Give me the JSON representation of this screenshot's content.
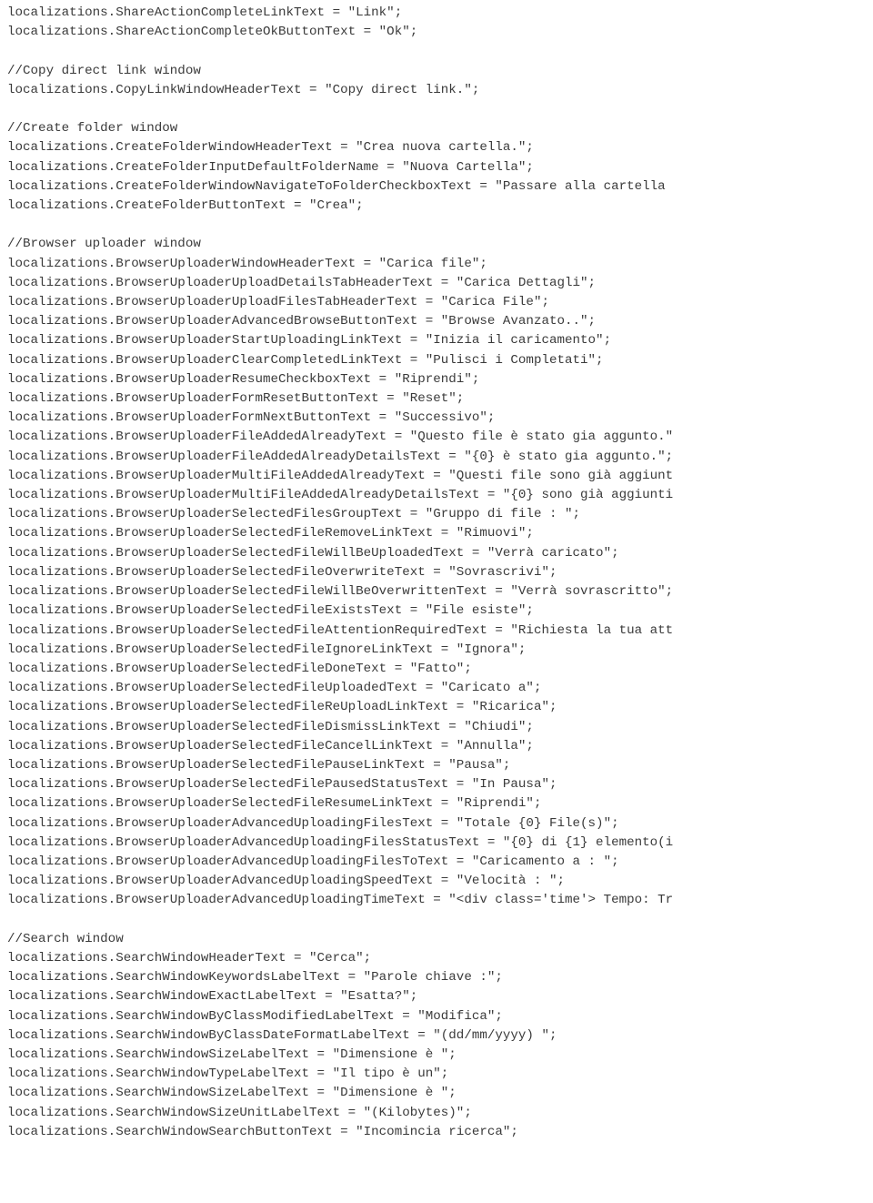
{
  "lines": [
    "localizations.ShareActionCompleteLinkText = \"Link\";",
    "localizations.ShareActionCompleteOkButtonText = \"Ok\";",
    "",
    "//Copy direct link window",
    "localizations.CopyLinkWindowHeaderText = \"Copy direct link.\";",
    "",
    "//Create folder window",
    "localizations.CreateFolderWindowHeaderText = \"Crea nuova cartella.\";",
    "localizations.CreateFolderInputDefaultFolderName = \"Nuova Cartella\";",
    "localizations.CreateFolderWindowNavigateToFolderCheckboxText = \"Passare alla cartella ",
    "localizations.CreateFolderButtonText = \"Crea\";",
    "",
    "//Browser uploader window",
    "localizations.BrowserUploaderWindowHeaderText = \"Carica file\";",
    "localizations.BrowserUploaderUploadDetailsTabHeaderText = \"Carica Dettagli\";",
    "localizations.BrowserUploaderUploadFilesTabHeaderText = \"Carica File\";",
    "localizations.BrowserUploaderAdvancedBrowseButtonText = \"Browse Avanzato..\";",
    "localizations.BrowserUploaderStartUploadingLinkText = \"Inizia il caricamento\";",
    "localizations.BrowserUploaderClearCompletedLinkText = \"Pulisci i Completati\";",
    "localizations.BrowserUploaderResumeCheckboxText = \"Riprendi\";",
    "localizations.BrowserUploaderFormResetButtonText = \"Reset\";",
    "localizations.BrowserUploaderFormNextButtonText = \"Successivo\";",
    "localizations.BrowserUploaderFileAddedAlreadyText = \"Questo file è stato gia aggunto.\"",
    "localizations.BrowserUploaderFileAddedAlreadyDetailsText = \"{0} è stato gia aggunto.\";",
    "localizations.BrowserUploaderMultiFileAddedAlreadyText = \"Questi file sono già aggiunt",
    "localizations.BrowserUploaderMultiFileAddedAlreadyDetailsText = \"{0} sono già aggiunti",
    "localizations.BrowserUploaderSelectedFilesGroupText = \"Gruppo di file : \";",
    "localizations.BrowserUploaderSelectedFileRemoveLinkText = \"Rimuovi\";",
    "localizations.BrowserUploaderSelectedFileWillBeUploadedText = \"Verrà caricato\";",
    "localizations.BrowserUploaderSelectedFileOverwriteText = \"Sovrascrivi\";",
    "localizations.BrowserUploaderSelectedFileWillBeOverwrittenText = \"Verrà sovrascritto\";",
    "localizations.BrowserUploaderSelectedFileExistsText = \"File esiste\";",
    "localizations.BrowserUploaderSelectedFileAttentionRequiredText = \"Richiesta la tua att",
    "localizations.BrowserUploaderSelectedFileIgnoreLinkText = \"Ignora\";",
    "localizations.BrowserUploaderSelectedFileDoneText = \"Fatto\";",
    "localizations.BrowserUploaderSelectedFileUploadedText = \"Caricato a\";",
    "localizations.BrowserUploaderSelectedFileReUploadLinkText = \"Ricarica\";",
    "localizations.BrowserUploaderSelectedFileDismissLinkText = \"Chiudi\";",
    "localizations.BrowserUploaderSelectedFileCancelLinkText = \"Annulla\";",
    "localizations.BrowserUploaderSelectedFilePauseLinkText = \"Pausa\";",
    "localizations.BrowserUploaderSelectedFilePausedStatusText = \"In Pausa\";",
    "localizations.BrowserUploaderSelectedFileResumeLinkText = \"Riprendi\";",
    "localizations.BrowserUploaderAdvancedUploadingFilesText = \"Totale {0} File(s)\";",
    "localizations.BrowserUploaderAdvancedUploadingFilesStatusText = \"{0} di {1} elemento(i",
    "localizations.BrowserUploaderAdvancedUploadingFilesToText = \"Caricamento a : \";",
    "localizations.BrowserUploaderAdvancedUploadingSpeedText = \"Velocità : \";",
    "localizations.BrowserUploaderAdvancedUploadingTimeText = \"<div class='time'> Tempo: Tr",
    "",
    "//Search window",
    "localizations.SearchWindowHeaderText = \"Cerca\";",
    "localizations.SearchWindowKeywordsLabelText = \"Parole chiave :\";",
    "localizations.SearchWindowExactLabelText = \"Esatta?\";",
    "localizations.SearchWindowByClassModifiedLabelText = \"Modifica\";",
    "localizations.SearchWindowByClassDateFormatLabelText = \"(dd/mm/yyyy) \";",
    "localizations.SearchWindowSizeLabelText = \"Dimensione è \";",
    "localizations.SearchWindowTypeLabelText = \"Il tipo è un\";",
    "localizations.SearchWindowSizeLabelText = \"Dimensione è \";",
    "localizations.SearchWindowSizeUnitLabelText = \"(Kilobytes)\";",
    "localizations.SearchWindowSearchButtonText = \"Incomincia ricerca\";"
  ]
}
